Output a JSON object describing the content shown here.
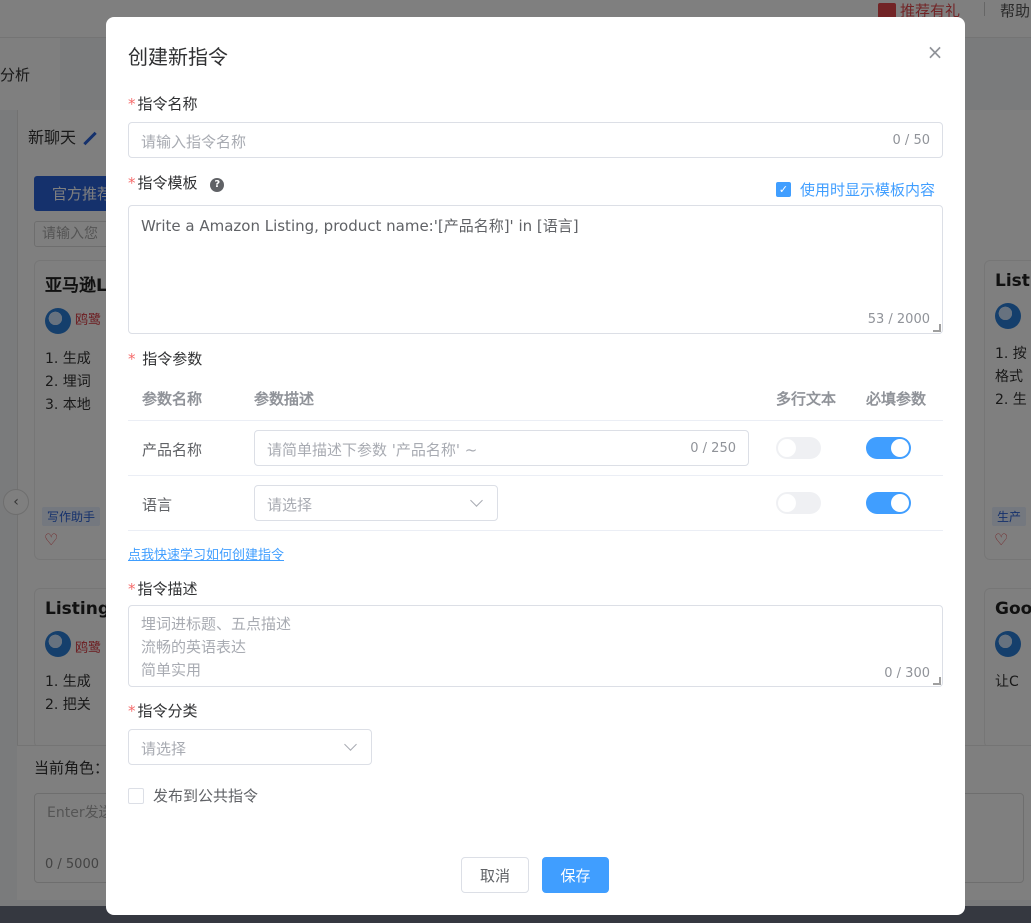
{
  "background": {
    "promo_label": "推荐有礼",
    "help_label": "帮助",
    "analysis_label": "分析",
    "new_chat_label": "新聊天",
    "official_tab_label": "官方推荐",
    "search_placeholder": "请输入您",
    "cards": [
      {
        "title": "亚马逊L",
        "author": "鸥鹭",
        "lines": [
          "1. 生成",
          "2. 埋词",
          "3. 本地"
        ],
        "tag": "写作助手"
      },
      {
        "title": "Listi",
        "author": "",
        "lines": [
          "1. 按",
          "格式",
          "2. 生"
        ],
        "tag": "生产"
      },
      {
        "title": "Listing",
        "author": "鸥鹭",
        "lines": [
          "1. 生成",
          "2. 把关"
        ],
        "tag": ""
      },
      {
        "title": "Good",
        "author": "",
        "lines": [
          "让C"
        ],
        "tag": ""
      }
    ],
    "role_label": "当前角色：",
    "input_placeholder": "Enter发送",
    "input_count": "0 / 5000"
  },
  "dialog": {
    "title": "创建新指令",
    "close_icon": "×",
    "name": {
      "required_mark": "*",
      "label": "指令名称",
      "placeholder": "请输入指令名称",
      "count": "0 / 50"
    },
    "template": {
      "required_mark": "*",
      "label": "指令模板",
      "help_icon": "?",
      "show_content_label": "使用时显示模板内容",
      "show_content_checked": true,
      "value": "Write a Amazon Listing, product name:'[产品名称]' in [语言]",
      "count": "53 / 2000"
    },
    "params": {
      "required_mark": "*",
      "label": "指令参数",
      "headers": {
        "name": "参数名称",
        "desc": "参数描述",
        "multiline": "多行文本",
        "required": "必填参数"
      },
      "rows": [
        {
          "name": "产品名称",
          "desc_placeholder": "请简单描述下参数 '产品名称' ~",
          "desc_count": "0 / 250",
          "multiline": false,
          "required": true
        },
        {
          "name": "语言",
          "select_placeholder": "请选择",
          "multiline": false,
          "required": true
        }
      ]
    },
    "learn_link": "点我快速学习如何创建指令",
    "description": {
      "required_mark": "*",
      "label": "指令描述",
      "placeholder_lines": [
        "埋词进标题、五点描述",
        "流畅的英语表达",
        "简单实用"
      ],
      "count": "0 / 300"
    },
    "category": {
      "required_mark": "*",
      "label": "指令分类",
      "placeholder": "请选择"
    },
    "publish_label": "发布到公共指令",
    "publish_checked": false,
    "cancel_label": "取消",
    "save_label": "保存"
  }
}
